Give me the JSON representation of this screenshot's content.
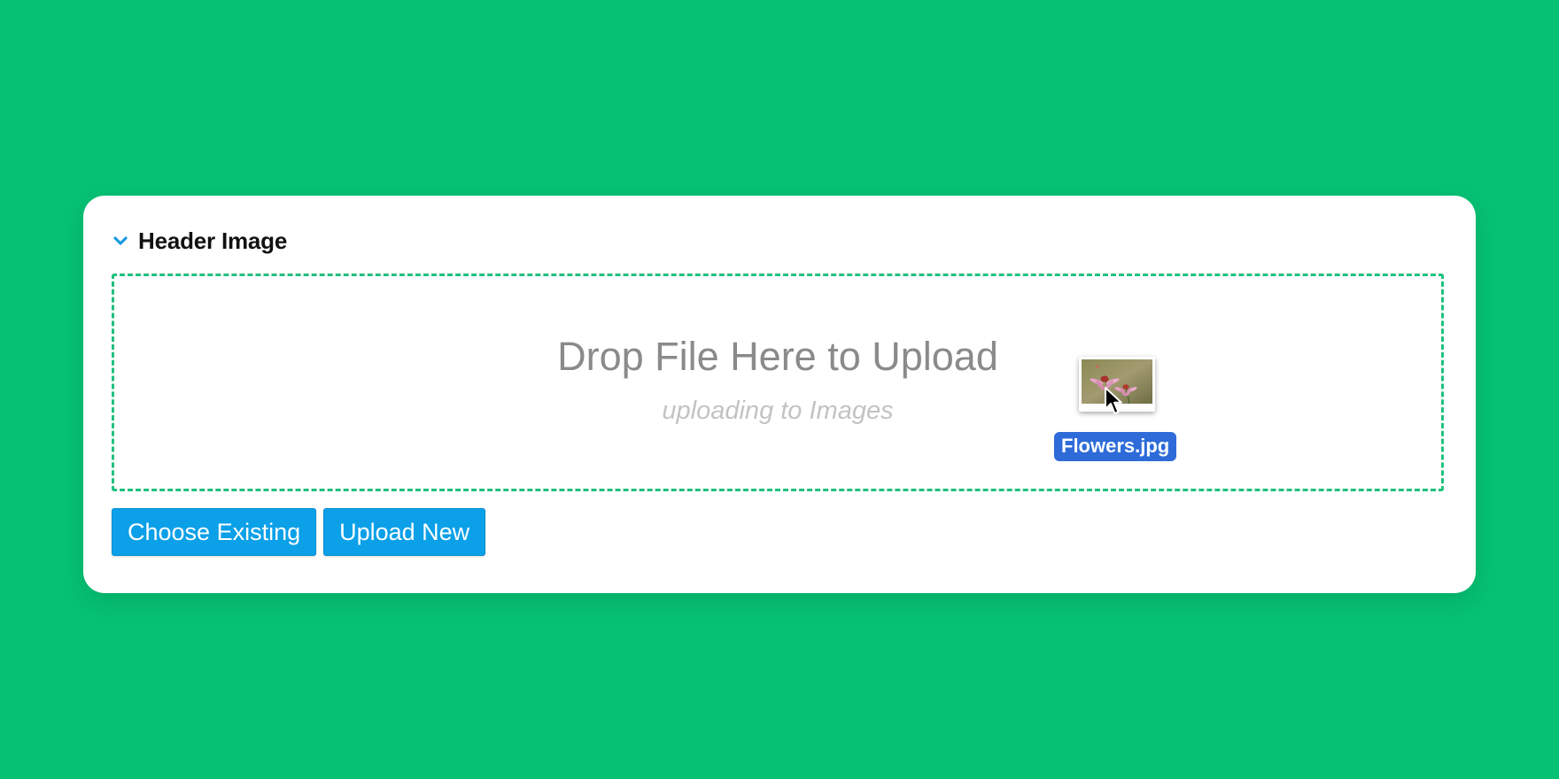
{
  "field": {
    "title": "Header Image",
    "icon": "chevron-down-icon"
  },
  "dropzone": {
    "title": "Drop File Here to Upload",
    "subtitle": "uploading to Images"
  },
  "drag": {
    "file_name": "Flowers.jpg"
  },
  "buttons": {
    "choose_existing": "Choose Existing",
    "upload_new": "Upload New"
  },
  "colors": {
    "background": "#06c173",
    "accent": "#0ba0e8",
    "dropzone_border": "#1fc07d",
    "file_label": "#2e6bd8"
  }
}
